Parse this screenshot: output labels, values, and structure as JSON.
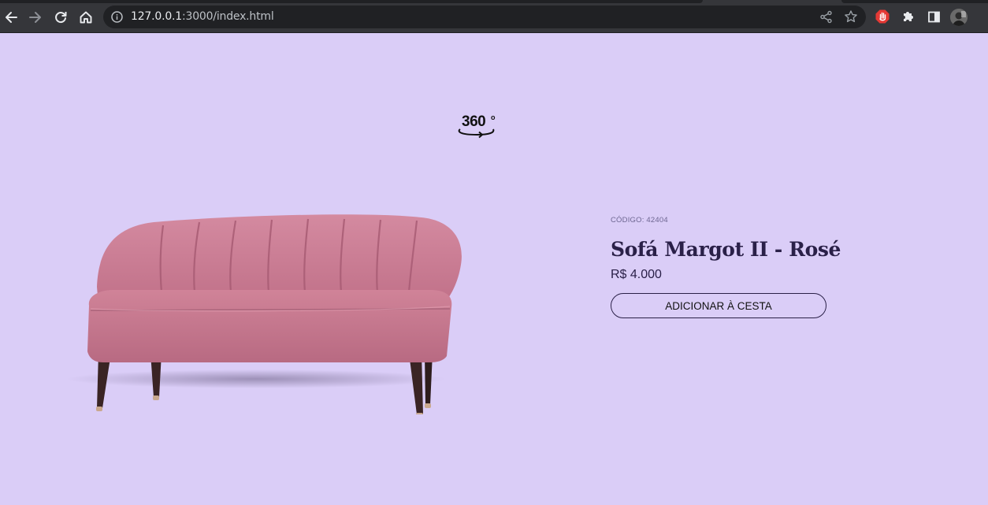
{
  "browser": {
    "url_host": "127.0.0.1",
    "url_rest": ":3000/index.html"
  },
  "viewer": {
    "label": "360",
    "degree": "o"
  },
  "product": {
    "sku_label": "CÓDIGO: 42404",
    "name": "Sofá Margot II - Rosé",
    "price": "R$ 4.000",
    "add_to_cart_label": "ADICIONAR À CESTA"
  },
  "colors": {
    "page_background": "#dacdf7",
    "text_primary": "#2a2048",
    "sofa_fabric": "#c7798f"
  }
}
